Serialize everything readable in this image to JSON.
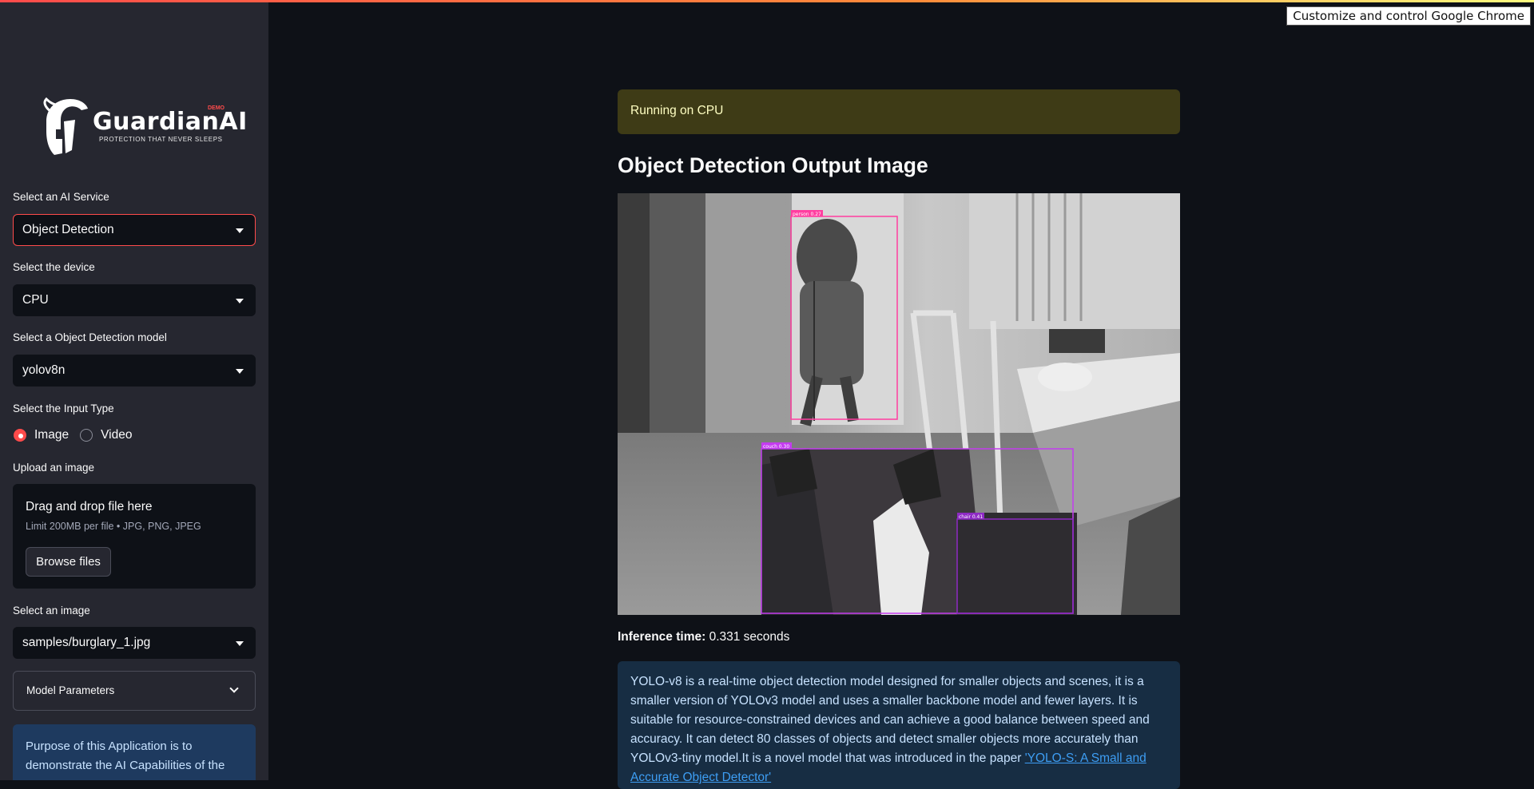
{
  "browser": {
    "tooltip": "Customize and control Google Chrome"
  },
  "sidebar": {
    "logo": {
      "brand": "GuardianAI",
      "badge": "DEMO",
      "tagline": "PROTECTION THAT NEVER SLEEPS"
    },
    "service": {
      "label": "Select an AI Service",
      "value": "Object Detection"
    },
    "device": {
      "label": "Select the device",
      "value": "CPU"
    },
    "model": {
      "label": "Select a Object Detection model",
      "value": "yolov8n"
    },
    "input_type": {
      "label": "Select the Input Type",
      "options": [
        "Image",
        "Video"
      ],
      "selected": "Image"
    },
    "upload": {
      "label": "Upload an image",
      "drop_text": "Drag and drop file here",
      "limit_text": "Limit 200MB per file • JPG, PNG, JPEG",
      "button": "Browse files"
    },
    "image_select": {
      "label": "Select an image",
      "value": "samples/burglary_1.jpg"
    },
    "params": {
      "label": "Model Parameters"
    },
    "purpose": "Purpose of this Application is to demonstrate the AI Capabilities of the"
  },
  "main": {
    "status": "Running on CPU",
    "heading": "Object Detection Output Image",
    "detections": [
      {
        "label": "person 0.27",
        "color": "#ff3ea0"
      },
      {
        "label": "couch 0.30",
        "color": "#c43cf0"
      },
      {
        "label": "chair 0.41",
        "color": "#8e2ac4"
      }
    ],
    "inference_label": "Inference time:",
    "inference_value": "0.331 seconds",
    "description_text": "YOLO-v8 is a real-time object detection model designed for smaller objects and scenes, it is a smaller version of YOLOv3 model and uses a smaller backbone model and fewer layers. It is suitable for resource-constrained devices and can achieve a good balance between speed and accuracy. It can detect 80 classes of objects and detect smaller objects more accurately than YOLOv3-tiny model.It is a novel model that was introduced in the paper ",
    "description_link": "'YOLO-S: A Small and Accurate Object Detector'"
  },
  "colors": {
    "accent": "#ff4b4b",
    "sidebar_bg": "#262730",
    "main_bg": "#0e1117",
    "warning_bg": "#3e3b16",
    "info_bg": "#172d43"
  }
}
